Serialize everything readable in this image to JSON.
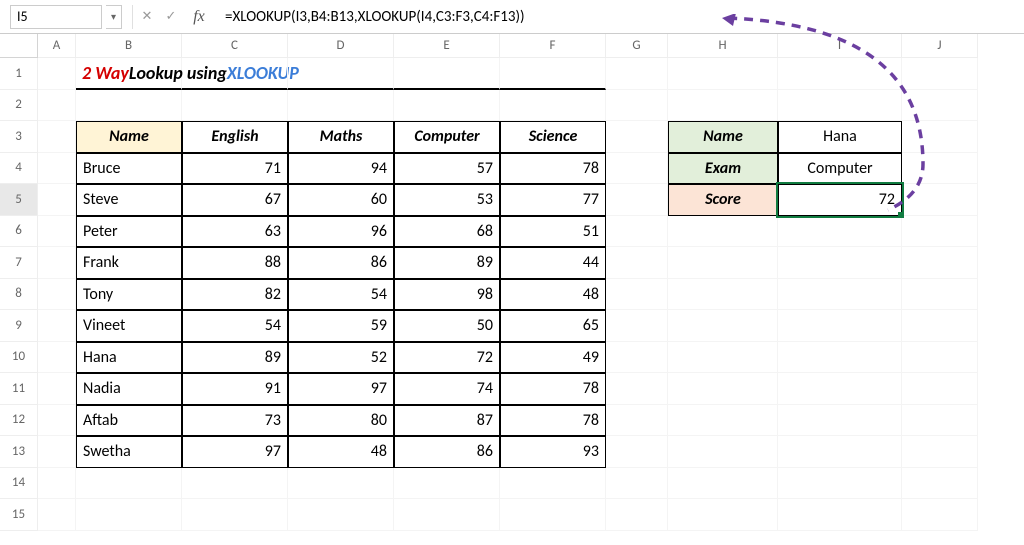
{
  "formula_bar": {
    "name_box": "I5",
    "formula": "=XLOOKUP(I3,B4:B13,XLOOKUP(I4,C3:F3,C4:F13))"
  },
  "columns": [
    "A",
    "B",
    "C",
    "D",
    "E",
    "F",
    "G",
    "H",
    "I",
    "J"
  ],
  "rows": [
    "1",
    "2",
    "3",
    "4",
    "5",
    "6",
    "7",
    "8",
    "9",
    "10",
    "11",
    "12",
    "13",
    "14",
    "15"
  ],
  "title": {
    "part1": "2 Way",
    "part2": "  Lookup using  ",
    "part3": "XLOOKUP"
  },
  "table": {
    "headers": [
      "Name",
      "English",
      "Maths",
      "Computer",
      "Science"
    ],
    "rows": [
      {
        "name": "Bruce",
        "english": 71,
        "maths": 94,
        "computer": 57,
        "science": 78
      },
      {
        "name": "Steve",
        "english": 67,
        "maths": 60,
        "computer": 53,
        "science": 77
      },
      {
        "name": "Peter",
        "english": 63,
        "maths": 96,
        "computer": 68,
        "science": 51
      },
      {
        "name": "Frank",
        "english": 88,
        "maths": 86,
        "computer": 89,
        "science": 44
      },
      {
        "name": "Tony",
        "english": 82,
        "maths": 54,
        "computer": 98,
        "science": 48
      },
      {
        "name": "Vineet",
        "english": 54,
        "maths": 59,
        "computer": 50,
        "science": 65
      },
      {
        "name": "Hana",
        "english": 89,
        "maths": 52,
        "computer": 72,
        "science": 49
      },
      {
        "name": "Nadia",
        "english": 91,
        "maths": 97,
        "computer": 74,
        "science": 78
      },
      {
        "name": "Aftab",
        "english": 73,
        "maths": 80,
        "computer": 87,
        "science": 78
      },
      {
        "name": "Swetha",
        "english": 97,
        "maths": 48,
        "computer": 86,
        "science": 93
      }
    ]
  },
  "lookup": {
    "name_label": "Name",
    "name_value": "Hana",
    "exam_label": "Exam",
    "exam_value": "Computer",
    "score_label": "Score",
    "score_value": 72
  },
  "selected_row": 5,
  "chart_data": {
    "type": "table",
    "title": "2 Way Lookup using XLOOKUP",
    "categories": [
      "English",
      "Maths",
      "Computer",
      "Science"
    ],
    "series": [
      {
        "name": "Bruce",
        "values": [
          71,
          94,
          57,
          78
        ]
      },
      {
        "name": "Steve",
        "values": [
          67,
          60,
          53,
          77
        ]
      },
      {
        "name": "Peter",
        "values": [
          63,
          96,
          68,
          51
        ]
      },
      {
        "name": "Frank",
        "values": [
          88,
          86,
          89,
          44
        ]
      },
      {
        "name": "Tony",
        "values": [
          82,
          54,
          98,
          48
        ]
      },
      {
        "name": "Vineet",
        "values": [
          54,
          59,
          50,
          65
        ]
      },
      {
        "name": "Hana",
        "values": [
          89,
          52,
          72,
          49
        ]
      },
      {
        "name": "Nadia",
        "values": [
          91,
          97,
          74,
          78
        ]
      },
      {
        "name": "Aftab",
        "values": [
          73,
          80,
          87,
          78
        ]
      },
      {
        "name": "Swetha",
        "values": [
          97,
          48,
          86,
          93
        ]
      }
    ],
    "lookup": {
      "Name": "Hana",
      "Exam": "Computer",
      "Score": 72
    }
  }
}
